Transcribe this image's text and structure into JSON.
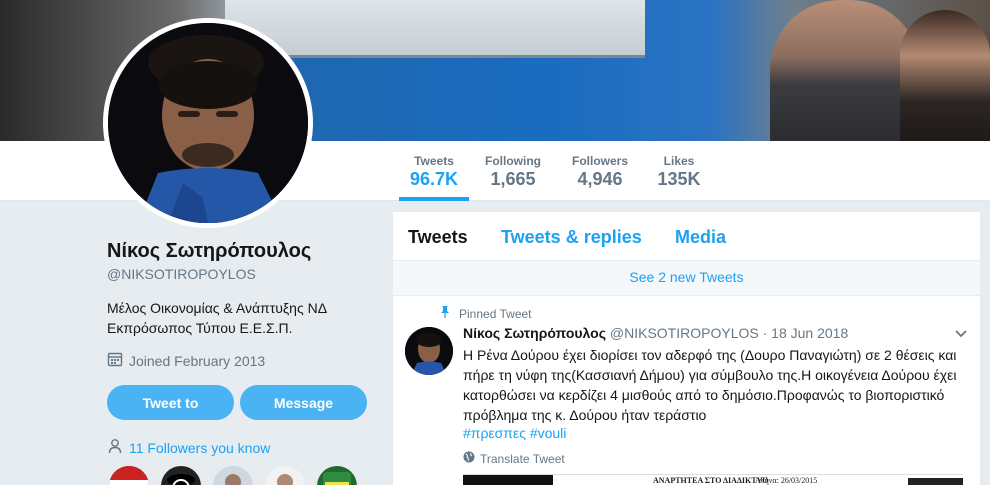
{
  "profile": {
    "name": "Νίκος Σωτηρόπουλος",
    "handle": "@NIKSOTIROPOYLOS",
    "bio_line1": "Μέλος Οικονομίας & Ανάπτυξης ΝΔ",
    "bio_line2": "Εκπρόσωπος Τύπου Ε.Ε.Σ.Π.",
    "joined": "Joined February 2013",
    "tweet_to_label": "Tweet to",
    "message_label": "Message",
    "followers_you_know": "11 Followers you know"
  },
  "stats": [
    {
      "label": "Tweets",
      "value": "96.7K",
      "active": true
    },
    {
      "label": "Following",
      "value": "1,665",
      "active": false
    },
    {
      "label": "Followers",
      "value": "4,946",
      "active": false
    },
    {
      "label": "Likes",
      "value": "135K",
      "active": false
    }
  ],
  "timeline": {
    "tabs": [
      "Tweets",
      "Tweets & replies",
      "Media"
    ],
    "new_tweets": "See 2 new Tweets"
  },
  "tweet": {
    "pinned_label": "Pinned Tweet",
    "name": "Νίκος Σωτηρόπουλος",
    "handle": "@NIKSOTIROPOYLOS",
    "date": "· 18 Jun 2018",
    "text": "Η Ρένα Δούρου έχει διορίσει τον αδερφό της (Δουρο Παναγιώτη) σε 2 θέσεις και πήρε τη νύφη της(Κασσιανή Δήμου) για σύμβουλο της.Η οικογένεια Δούρου έχει κατορθώσει να κερδίζει 4 μισθούς από το δημόσιο.Προφανώς το βιοποριστικό πρόβλημα της κ. Δούρου ήταν τεράστιο",
    "hashtags": "#πρεσπες #vouli",
    "translate_label": "Translate Tweet",
    "media_caption": "ΑΝΑΡΤΗΤΕΑ ΣΤΟ ΔΙΑΔΙΚΤΥΟ",
    "media_date": "Αθήνα: 26/03/2015"
  },
  "colors": {
    "accent": "#1da1f2",
    "button": "#4ab3f4",
    "background": "#e6ecf0",
    "muted": "#657786"
  },
  "icons": {
    "calendar": "calendar-icon",
    "person": "person-icon",
    "pin": "pin-icon",
    "globe": "globe-icon",
    "caret": "chevron-down-icon"
  }
}
